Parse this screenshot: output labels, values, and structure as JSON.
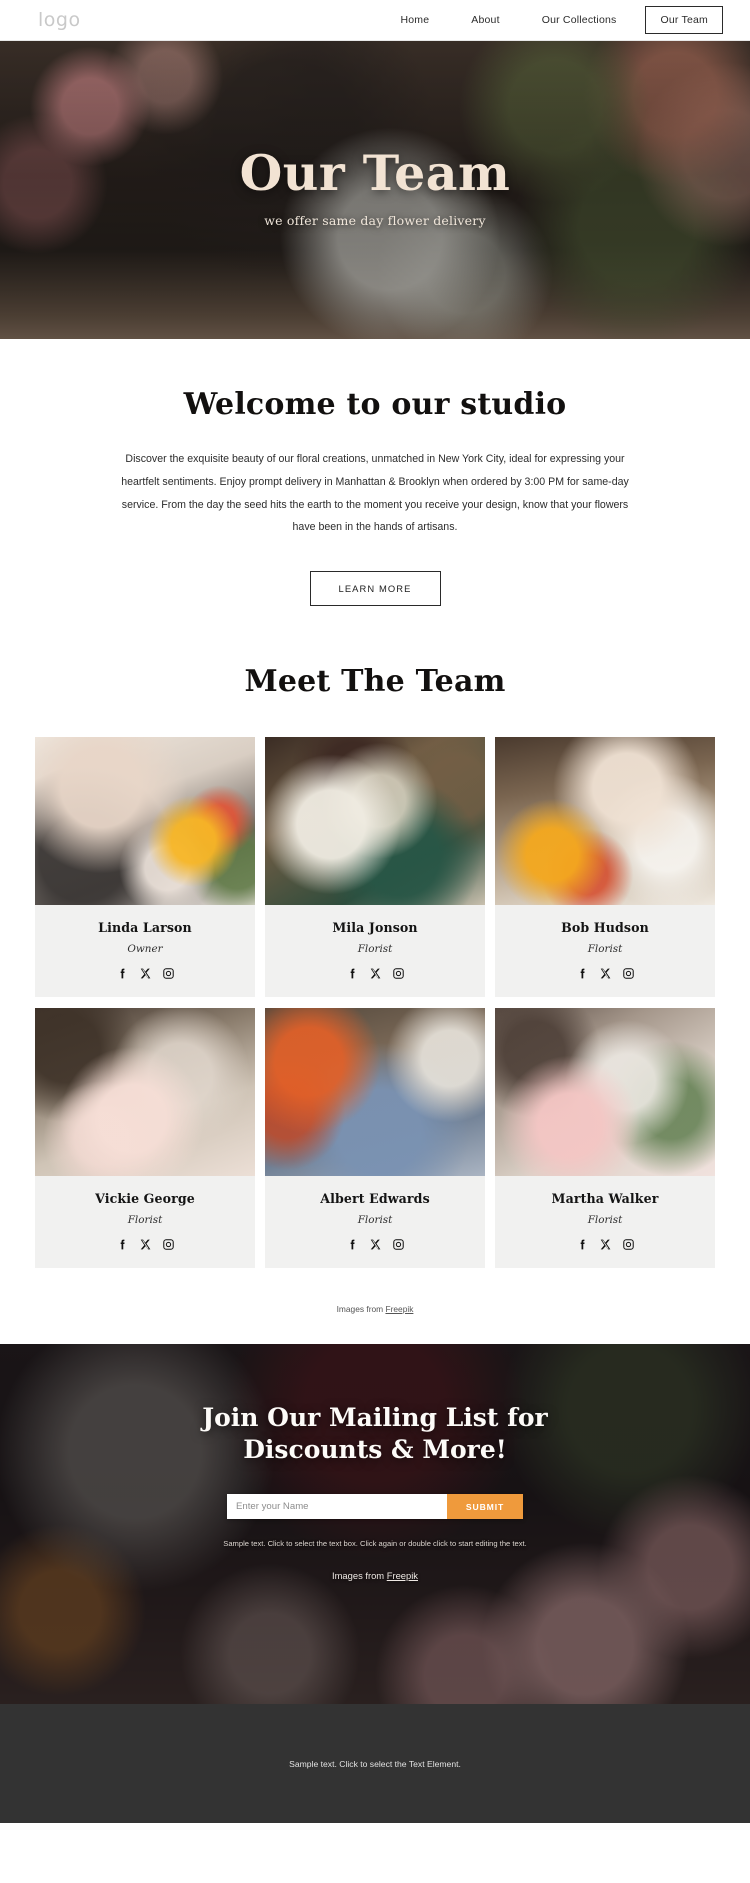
{
  "header": {
    "logo": "logo",
    "nav": [
      {
        "label": "Home",
        "active": false
      },
      {
        "label": "About",
        "active": false
      },
      {
        "label": "Our Collections",
        "active": false
      },
      {
        "label": "Our Team",
        "active": true
      }
    ]
  },
  "hero": {
    "title": "Our Team",
    "subtitle": "we offer same day flower delivery"
  },
  "welcome": {
    "title": "Welcome to our studio",
    "body": "Discover the exquisite beauty of our floral creations, unmatched in New York City, ideal for expressing your heartfelt sentiments. Enjoy prompt delivery in Manhattan & Brooklyn when ordered by 3:00 PM for same-day service.  From the day the seed hits the earth to the moment you receive your design, know that your flowers have been in the hands of artisans.",
    "cta_label": "LEARN MORE"
  },
  "team": {
    "title": "Meet The Team",
    "members": [
      {
        "name": "Linda Larson",
        "role": "Owner",
        "photo": "p1"
      },
      {
        "name": "Mila Jonson",
        "role": "Florist",
        "photo": "p2"
      },
      {
        "name": "Bob Hudson",
        "role": "Florist",
        "photo": "p3"
      },
      {
        "name": "Vickie George",
        "role": "Florist",
        "photo": "p4"
      },
      {
        "name": "Albert Edwards",
        "role": "Florist",
        "photo": "p5"
      },
      {
        "name": "Martha Walker",
        "role": "Florist",
        "photo": "p6"
      }
    ],
    "social_icons": [
      "facebook-icon",
      "x-twitter-icon",
      "instagram-icon"
    ],
    "credit_prefix": "Images from ",
    "credit_link": "Freepik"
  },
  "mailing": {
    "title_line1": "Join Our Mailing List for",
    "title_line2": "Discounts & More!",
    "input_placeholder": "Enter your Name",
    "input_value": "",
    "submit_label": "SUBMIT",
    "note": "Sample text. Click to select the text box. Click again or double click to start editing the text.",
    "credit_prefix": "Images from ",
    "credit_link": "Freepik"
  },
  "footer": {
    "text": "Sample text. Click to select the Text Element."
  },
  "colors": {
    "accent_orange": "#ef9a3c",
    "hero_title": "#f2e3d3",
    "card_bg": "#f1f1f0",
    "footer_bg": "#333333"
  }
}
